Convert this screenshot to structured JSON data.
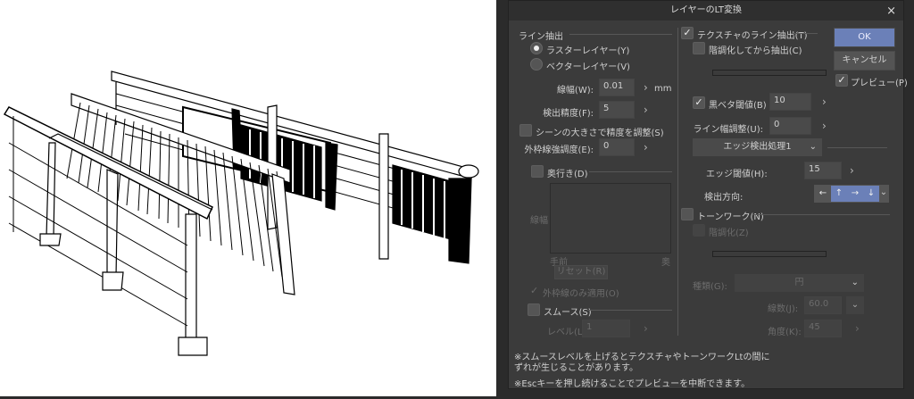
{
  "dialog": {
    "title": "レイヤーのLT変換",
    "close_icon": "×"
  },
  "left": {
    "line_extract": "ライン抽出",
    "radio_raster": "ラスターレイヤー(Y)",
    "radio_vector": "ベクターレイヤー(V)",
    "line_width_label": "線幅(W):",
    "line_width_value": "0.01",
    "line_width_unit": "mm",
    "precision_label": "検出精度(F):",
    "precision_value": "5",
    "scene_adjust": "シーンの大きさで精度を調整(S)",
    "outline_label": "外枠線強調度(E):",
    "outline_value": "0",
    "depth": "奥行き(D)",
    "graph_y_label": "線幅",
    "graph_near": "手前",
    "graph_far": "奥",
    "reset": "リセット(R)",
    "outline_only": "外枠線のみ適用(O)",
    "smooth": "スムース(S)",
    "level_label": "レベル(L):",
    "level_value": "1"
  },
  "right": {
    "texture_extract": "テクスチャのライン抽出(T)",
    "posterize_extract": "階調化してから抽出(C)",
    "black_threshold": "黒ベタ閾値(B)",
    "black_threshold_value": "10",
    "line_width_adjust_label": "ライン幅調整(U):",
    "line_width_adjust_value": "0",
    "edge_process": "エッジ検出処理1",
    "edge_threshold_label": "エッジ閾値(H):",
    "edge_threshold_value": "15",
    "direction_label": "検出方向:",
    "directions": [
      "←",
      "↑",
      "→",
      "↓"
    ],
    "tonework": "トーンワーク(N)",
    "posterize": "階調化(Z)",
    "type_label": "種類(G):",
    "type_value": "円",
    "lines_label": "線数(J):",
    "lines_value": "60.0",
    "angle_label": "角度(K):",
    "angle_value": "45"
  },
  "buttons": {
    "ok": "OK",
    "cancel": "キャンセル",
    "preview": "プレビュー(P)"
  },
  "notes": [
    "※スムースレベルを上げるとテクスチャやトーンワークLtの間に",
    "ずれが生じることがあります。",
    "※Escキーを押し続けることでプレビューを中断できます。"
  ],
  "colors": {
    "accent": "#6b80b8"
  }
}
